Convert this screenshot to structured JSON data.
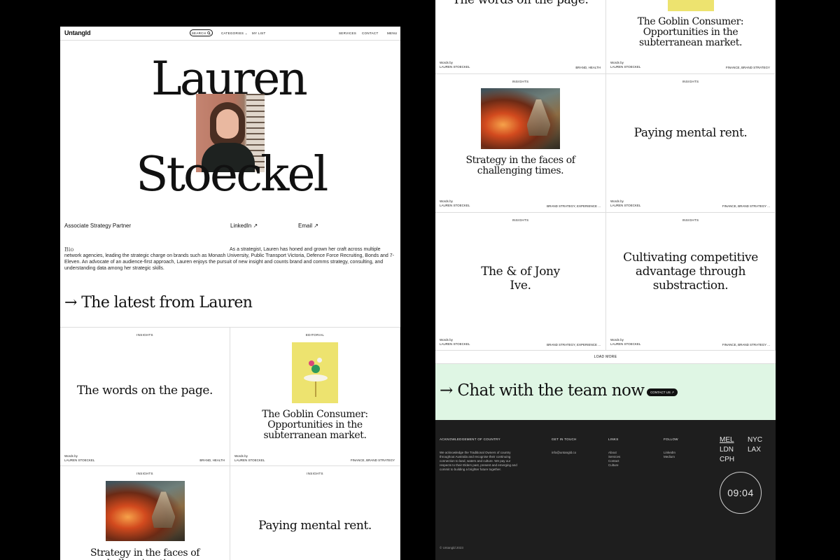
{
  "nav": {
    "logo": "Untangld",
    "search": "SEARCH",
    "categories": "CATEGORIES",
    "my_list": "MY LIST",
    "services": "SERVICES",
    "contact": "CONTACT",
    "menu": "MENU"
  },
  "profile": {
    "first_name": "Lauren",
    "last_name": "Stoeckel",
    "role": "Associate Strategy Partner",
    "linkedin": "LinkedIn ↗",
    "email": "Email ↗",
    "bio_label": "Bio",
    "bio": "As a strategist, Lauren has honed and grown her craft across multiple network agencies, leading the strategic charge on brands such as Monash University, Public Transport Victoria, Defence Force Recruiting, Bonds and 7-Eleven. An advocate of an audience-first approach, Lauren enjoys the pursuit of new insight and counts brand and comms strategy, consulting, and understanding data among her strategic skills."
  },
  "latest_heading": "→ The latest from Lauren",
  "left_cards": [
    {
      "tag": "INSIGHTS",
      "title": "The words on the page.",
      "words_by": "Words by",
      "author": "LAUREN STOECKEL",
      "cats": "BRAND, HEALTH"
    },
    {
      "tag": "EDITORIAL",
      "title": "The Goblin Consumer: Opportunities in the subterranean market.",
      "words_by": "Words by",
      "author": "LAUREN STOECKEL",
      "cats": "FINANCE, BRAND STRATEGY"
    },
    {
      "tag": "INSIGHTS",
      "title": "Strategy in the faces of challenging times."
    },
    {
      "tag": "INSIGHTS",
      "title": "Paying mental rent."
    }
  ],
  "right_cards": [
    {
      "tag": "",
      "title": "The words on the page.",
      "words_by": "Words by",
      "author": "LAUREN STOECKEL",
      "cats": "BRAND, HEALTH"
    },
    {
      "tag": "",
      "title": "The Goblin Consumer: Opportunities in the subterranean market.",
      "words_by": "Words by",
      "author": "LAUREN STOECKEL",
      "cats": "FINANCE, BRAND STRATEGY"
    },
    {
      "tag": "INSIGHTS",
      "title": "Strategy in the faces of challenging times.",
      "words_by": "Words by",
      "author": "LAUREN STOECKEL",
      "cats": "BRAND STRATEGY, EXPERIENCE ..."
    },
    {
      "tag": "INSIGHTS",
      "title": "Paying mental rent.",
      "words_by": "Words by",
      "author": "LAUREN STOECKEL",
      "cats": "FINANCE, BRAND STRATEGY ..."
    },
    {
      "tag": "INSIGHTS",
      "title": "The & of Jony Ive.",
      "words_by": "Words by",
      "author": "LAUREN STOECKEL",
      "cats": "BRAND STRATEGY, EXPERIENCE ..."
    },
    {
      "tag": "INSIGHTS",
      "title": "Cultivating competitive advantage through substraction.",
      "words_by": "Words by",
      "author": "LAUREN STOECKEL",
      "cats": "FINANCE, BRAND STRATEGY ..."
    }
  ],
  "load_more": "LOAD MORE",
  "chat": {
    "text": "→ Chat with the team now",
    "button": "CONTACT US ↗"
  },
  "footer": {
    "ack_heading": "ACKNOWLEDGEMENT OF COUNTRY",
    "ack_text": "We acknowledge the Traditional Owners of country throughout Australia and recognise their continuing connection to land, waters and culture. We pay our respects to their Elders past, present and emerging and commit to building a brighter future together.",
    "touch_heading": "GET IN TOUCH",
    "touch_email": "info@untangld.co",
    "links_heading": "LINKS",
    "links": [
      "About",
      "Services",
      "Contact",
      "Culture"
    ],
    "follow_heading": "FOLLOW",
    "follow": [
      "LinkedIn",
      "Medium"
    ],
    "cities": [
      "MEL",
      "NYC",
      "LDN",
      "LAX",
      "CPH"
    ],
    "time": "09:04",
    "copyright": "© Untangld 2023"
  },
  "colors": {
    "chat_bg": "#dff6e4",
    "footer_bg": "#1e1e1e",
    "page_bg": "#000000"
  }
}
